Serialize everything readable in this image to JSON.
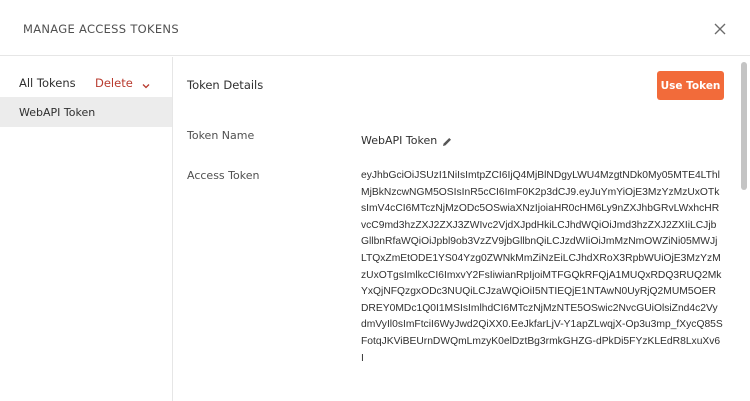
{
  "dialog": {
    "title": "MANAGE ACCESS TOKENS",
    "close_icon": "close-icon"
  },
  "sidebar": {
    "all_tokens_label": "All Tokens",
    "delete_label": "Delete",
    "delete_dropdown_icon": "chevron-down-icon",
    "items": [
      {
        "label": "WebAPI Token",
        "selected": true
      }
    ]
  },
  "details": {
    "heading": "Token Details",
    "use_token_label": "Use Token",
    "token_name_label": "Token Name",
    "token_name_value": "WebAPI Token",
    "edit_icon": "pencil-icon",
    "access_token_label": "Access Token",
    "access_token_value": "eyJhbGciOiJSUzI1NiIsImtpZCI6IjQ4MjBlNDgyLWU4MzgtNDk0My05MTE4LThlMjBkNzcwNGM5OSIsInR5cCI6ImF0K2p3dCJ9.eyJuYmYiOjE3MzYzMzUxOTksImV4cCI6MTczNjMzODc5OSwiaXNzIjoiaHR0cHM6Ly9nZXJhbGRvLWxhcHRvcC9md3hzZXJ2ZXJ3ZWIvc2VjdXJpdHkiLCJhdWQiOiJmd3hzZXJ2ZXIiLCJjbGllbnRfaWQiOiJpbl9ob3VzZV9jbGllbnQiLCJzdWIiOiJmMzNmOWZiNi05MWJjLTQxZmEtODE1YS04Yzg0ZWNkMmZiNzEiLCJhdXRoX3RpbWUiOjE3MzYzMzUxOTgsImlkcCI6ImxvY2FsIiwianRpIjoiMTFGQkRFQjA1MUQxRDQ3RUQ2MkYxQjNFQzgxODc3NUQiLCJzaWQiOiI5NTIEQjE1NTAwN0UyRjQ2MUM5OERDREY0MDc1Q0I1MSIsImlhdCI6MTczNjMzNTE5OSwic2NvcGUiOlsiZnd4c2VydmVyIl0sImFtciI6WyJwd2QiXX0.EeJkfarLjV-Y1apZLwqjX-Op3u3mp_fXycQ85SFotqJKViBEUrnDWQmLmzyK0elDztBg3rmkGHZG-dPkDi5FYzKLEdR8LxuXv6I"
  },
  "scrollbar": {
    "position_fraction": 0
  }
}
